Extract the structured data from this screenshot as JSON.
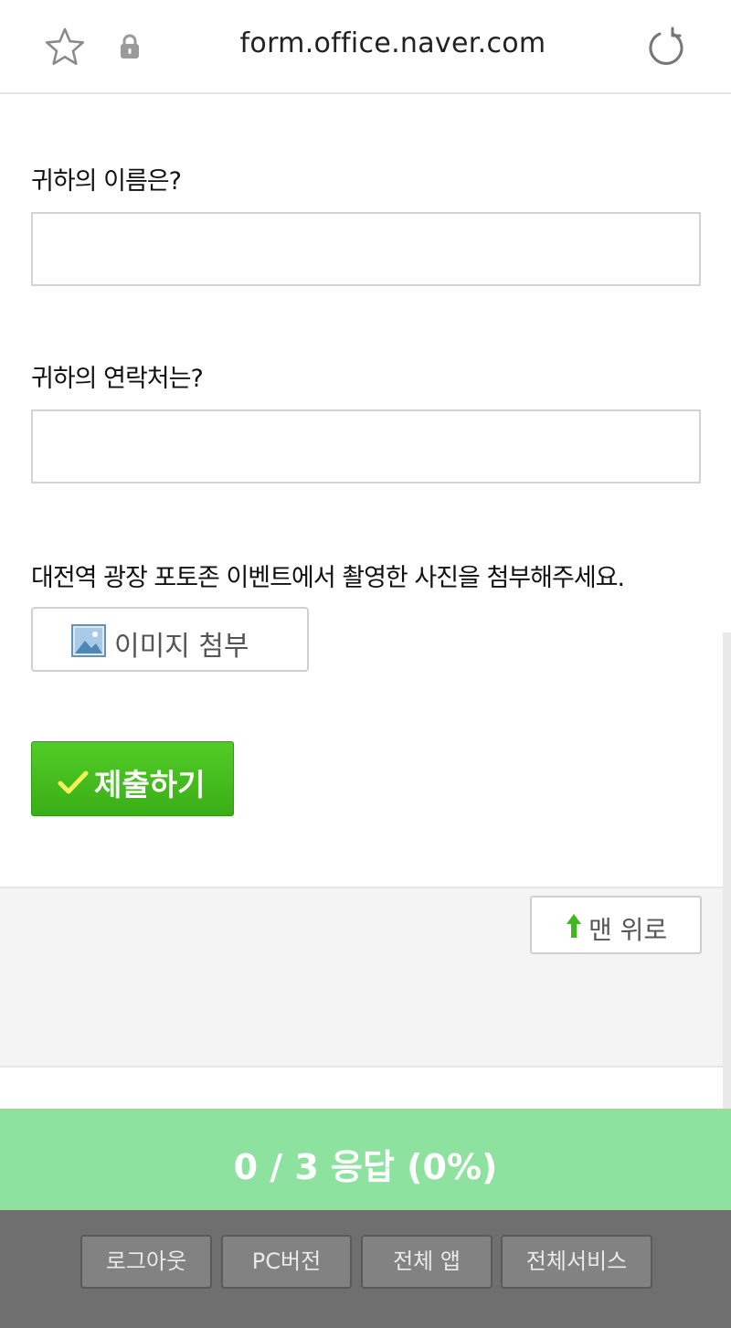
{
  "browser": {
    "url": "form.office.naver.com",
    "bookmark_icon": "star-icon",
    "secure_icon": "lock-icon",
    "reload_icon": "reload-icon"
  },
  "form": {
    "questions": [
      {
        "label": "귀하의 이름은?",
        "value": ""
      },
      {
        "label": "귀하의 연락처는?",
        "value": ""
      }
    ],
    "photo_question": "대전역 광장 포토존 이벤트에서 촬영한 사진을 첨부해주세요.",
    "attach_label": "이미지 첨부",
    "attach_icon": "image-icon",
    "submit_label": "제출하기",
    "submit_icon": "check-icon"
  },
  "footer": {
    "scroll_top_label": "맨 위로",
    "scroll_top_icon": "arrow-up-icon"
  },
  "progress": {
    "text": "0 / 3 응답 (0%)",
    "answered": 0,
    "total": 3,
    "percent": 0
  },
  "bottom_nav": {
    "items": [
      "로그아웃",
      "PC버전",
      "전체 앱",
      "전체서비스"
    ]
  },
  "colors": {
    "accent_green": "#3fb81c",
    "progress_green": "#8ee2a0",
    "nav_gray": "#6f6f6f"
  }
}
